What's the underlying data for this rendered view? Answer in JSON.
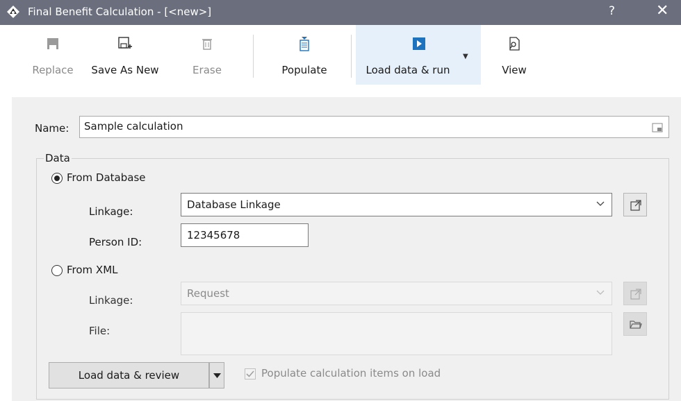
{
  "window": {
    "title": "Final Benefit Calculation - [<new>]",
    "help": "?",
    "close": "✕"
  },
  "toolbar": {
    "replace": "Replace",
    "save_as_new": "Save As New",
    "erase": "Erase",
    "populate": "Populate",
    "load_data_run": "Load data & run",
    "view": "View"
  },
  "form": {
    "name_label": "Name:",
    "name_value": "Sample calculation",
    "data_group_label": "Data",
    "from_database": {
      "label": "From Database",
      "selected": true,
      "linkage_label": "Linkage:",
      "linkage_value": "Database Linkage",
      "person_id_label": "Person ID:",
      "person_id_value": "12345678"
    },
    "from_xml": {
      "label": "From XML",
      "selected": false,
      "linkage_label": "Linkage:",
      "linkage_value": "Request",
      "file_label": "File:",
      "file_value": ""
    },
    "load_review_button": "Load data & review",
    "populate_checkbox_label": "Populate calculation items on load",
    "populate_checkbox_checked": true
  },
  "colors": {
    "titlebar": "#6b6f7d",
    "accent": "#1e73be",
    "panel": "#f0f0f0"
  }
}
